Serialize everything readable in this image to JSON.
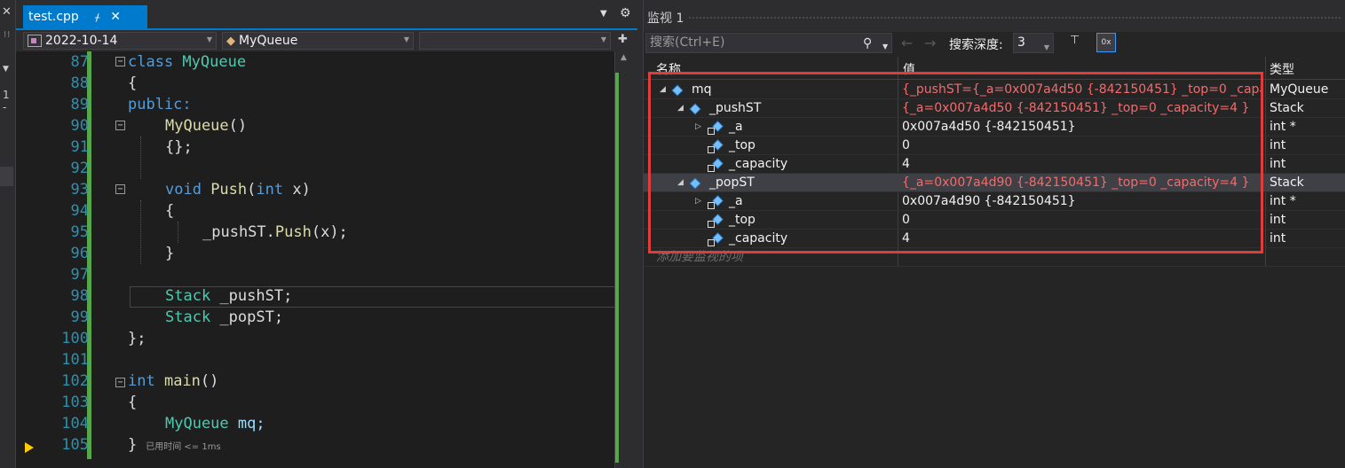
{
  "editor": {
    "tab_label": "test.cpp",
    "tab_pin": "ᚋ",
    "tab_close": "✕",
    "nav_scope": "2022-10-14",
    "nav_class": "MyQueue",
    "nav_member": "",
    "hint_text": "已用时间 <= 1ms",
    "lines": [
      {
        "n": "87"
      },
      {
        "n": "88"
      },
      {
        "n": "89"
      },
      {
        "n": "90"
      },
      {
        "n": "91"
      },
      {
        "n": "92"
      },
      {
        "n": "93"
      },
      {
        "n": "94"
      },
      {
        "n": "95"
      },
      {
        "n": "96"
      },
      {
        "n": "97"
      },
      {
        "n": "98"
      },
      {
        "n": "99"
      },
      {
        "n": "100"
      },
      {
        "n": "101"
      },
      {
        "n": "102"
      },
      {
        "n": "103"
      },
      {
        "n": "104"
      },
      {
        "n": "105"
      }
    ],
    "code": {
      "l87_kw": "class",
      "l87_name": " MyQueue",
      "l88": "{",
      "l89": "public:",
      "l90": "MyQueue",
      "l90_paren": "()",
      "l91": "{};",
      "l93_kw": "void",
      "l93_fn": " Push",
      "l93_p1": "(",
      "l93_int": "int",
      "l93_rest": " x)",
      "l94": "{",
      "l95_a": "_pushST.",
      "l95_fn": "Push",
      "l95_b": "(x);",
      "l96": "}",
      "l98_ty": "Stack",
      "l98_rest": " _pushST;",
      "l99_ty": "Stack",
      "l99_rest": " _popST;",
      "l100": "};",
      "l102_kw": "int",
      "l102_fn": " main",
      "l102_rest": "()",
      "l103": "{",
      "l104_ty": "MyQueue",
      "l104_rest": " mq;",
      "l105": "}"
    }
  },
  "left_strip": {
    "one": "1 -"
  },
  "watch": {
    "title": "监视 1",
    "search_placeholder": "搜索(Ctrl+E)",
    "depth_label": "搜索深度:",
    "depth_value": "3",
    "columns": {
      "name": "名称",
      "value": "值",
      "type": "类型"
    },
    "rows": [
      {
        "name": "mq",
        "value": "{_pushST={_a=0x007a4d50 {-842150451} _top=0 _capacity=...",
        "type": "MyQueue"
      },
      {
        "name": "_pushST",
        "value": "{_a=0x007a4d50 {-842150451} _top=0 _capacity=4 }",
        "type": "Stack"
      },
      {
        "name": "_a",
        "value": "0x007a4d50 {-842150451}",
        "type": "int *"
      },
      {
        "name": "_top",
        "value": "0",
        "type": "int"
      },
      {
        "name": "_capacity",
        "value": "4",
        "type": "int"
      },
      {
        "name": "_popST",
        "value": "{_a=0x007a4d90 {-842150451} _top=0 _capacity=4 }",
        "type": "Stack"
      },
      {
        "name": "_a",
        "value": "0x007a4d90 {-842150451}",
        "type": "int *"
      },
      {
        "name": "_top",
        "value": "0",
        "type": "int"
      },
      {
        "name": "_capacity",
        "value": "4",
        "type": "int"
      }
    ],
    "add_item": "添加要监视的项"
  },
  "colors": {
    "accent": "#007acc",
    "highlight_box": "#e03c3c",
    "changed_value": "#f26c6c"
  }
}
